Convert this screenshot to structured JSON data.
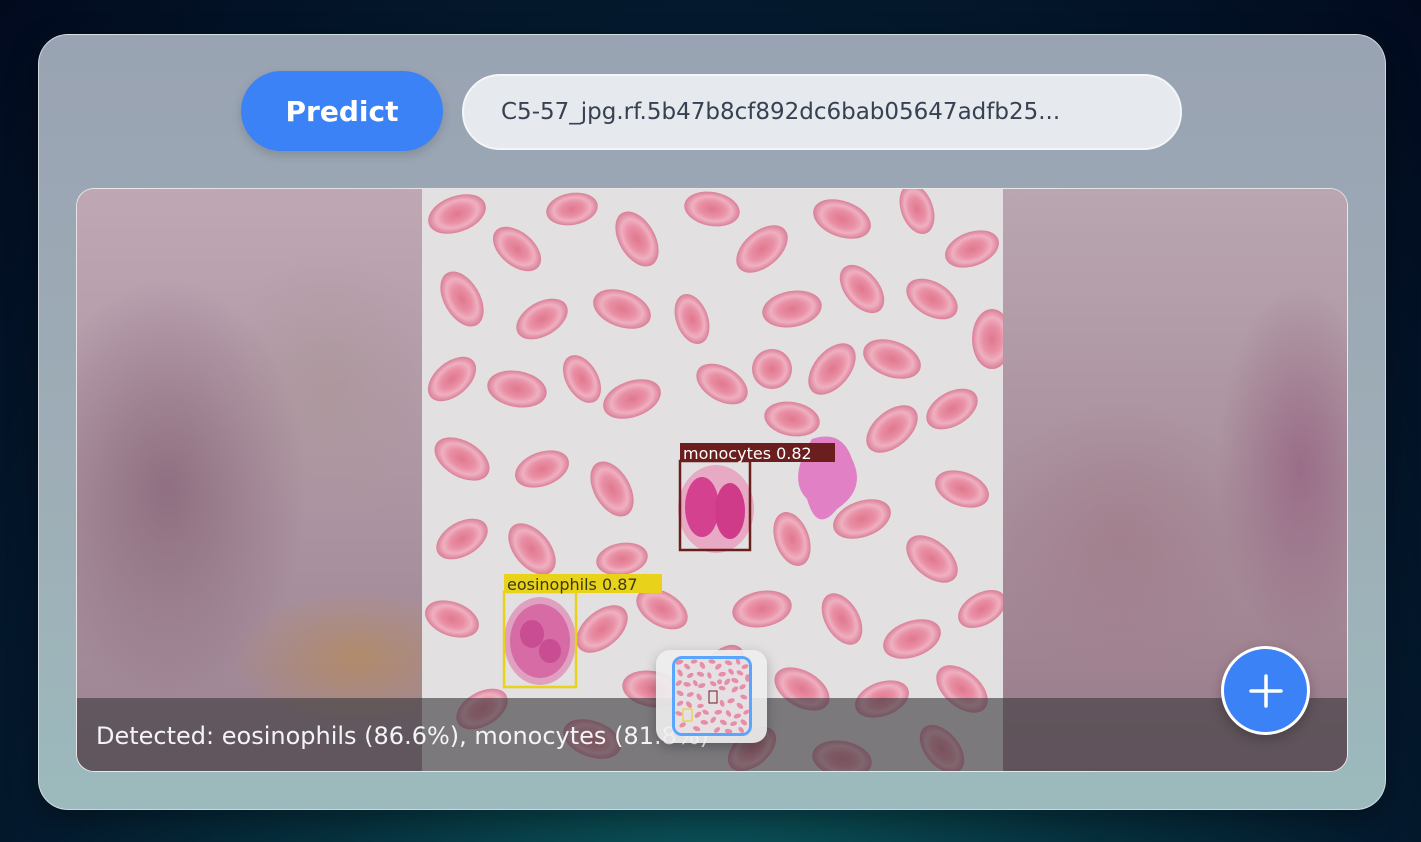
{
  "toolbar": {
    "predict_label": "Predict",
    "file_name": "C5-57_jpg.rf.5b47b8cf892dc6bab05647adfb25..."
  },
  "viewer": {
    "detections": [
      {
        "label": "monocytes 0.82",
        "color": "#6b1e1e"
      },
      {
        "label": "eosinophils 0.87",
        "color": "#e8d21a"
      }
    ],
    "caption": "Detected: eosinophils (86.6%), monocytes (81.8%)"
  },
  "colors": {
    "accent": "#3b82f6",
    "thumb_border": "#5aa5ff"
  },
  "icons": {
    "add": "plus-icon"
  }
}
